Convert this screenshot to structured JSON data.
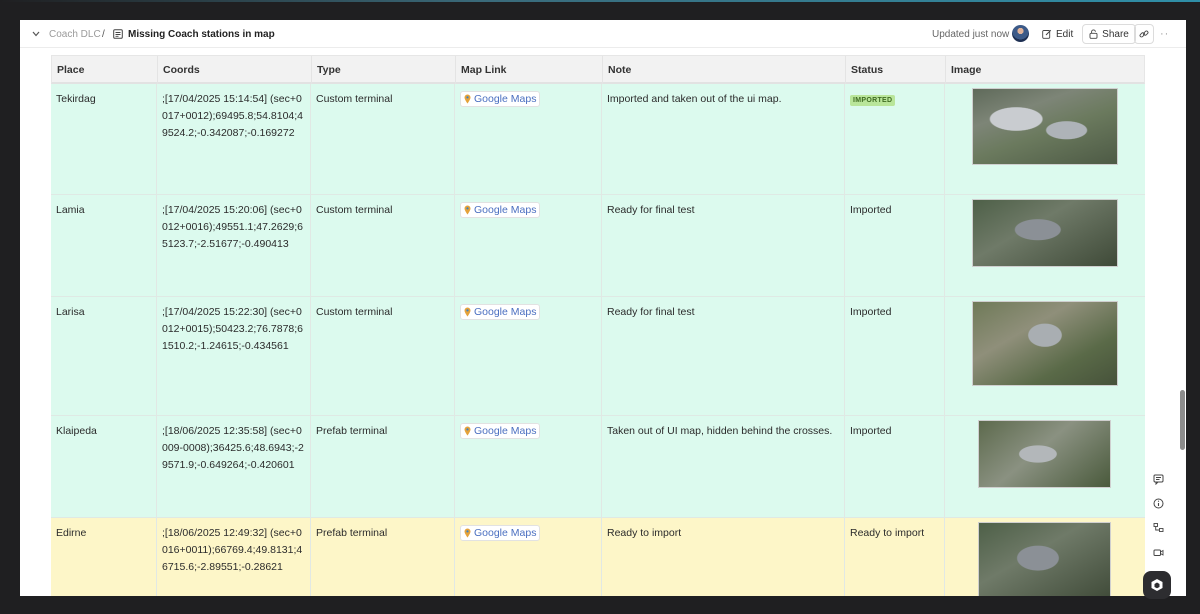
{
  "breadcrumb": {
    "parent": "Coach DLC",
    "separator": "/",
    "title": "Missing Coach stations in map"
  },
  "header": {
    "updated": "Updated just now",
    "edit_label": "Edit",
    "share_label": "Share"
  },
  "table": {
    "columns": [
      "Place",
      "Coords",
      "Type",
      "Map Link",
      "Note",
      "Status",
      "Image"
    ],
    "rows": [
      {
        "place": "Tekirdag",
        "coords": ";[17/04/2025 15:14:54] (sec+0017+0012);69495.8;54.8104;49524.2;-0.342087;-0.169272",
        "type": "Custom terminal",
        "map_link": "Google Maps",
        "note": "Imported and taken out of the ui map.",
        "status": "IMPORTED",
        "status_style": "badge"
      },
      {
        "place": "Lamia",
        "coords": ";[17/04/2025 15:20:06] (sec+0012+0016);49551.1;47.2629;65123.7;-2.51677;-0.490413",
        "type": "Custom terminal",
        "map_link": "Google Maps",
        "note": "Ready for final test",
        "status": "Imported",
        "status_style": "text"
      },
      {
        "place": "Larisa",
        "coords": ";[17/04/2025 15:22:30] (sec+0012+0015);50423.2;76.7878;61510.2;-1.24615;-0.434561",
        "type": "Custom terminal",
        "map_link": "Google Maps",
        "note": "Ready for final test",
        "status": "Imported",
        "status_style": "text"
      },
      {
        "place": "Klaipeda",
        "coords": " ;[18/06/2025 12:35:58] (sec+0009-0008);36425.6;48.6943;-29571.9;-0.649264;-0.420601",
        "type": "Prefab terminal",
        "map_link": "Google Maps",
        "note": "Taken out of UI map, hidden behind the crosses.",
        "status": "Imported",
        "status_style": "text"
      },
      {
        "place": "Edirne",
        "coords": " ;[18/06/2025 12:49:32] (sec+0016+0011);66769.4;49.8131;46715.6;-2.89551;-0.28621",
        "type": "Prefab terminal",
        "map_link": "Google Maps",
        "note": "Ready to import",
        "status": "Ready to import",
        "status_style": "text"
      }
    ]
  },
  "colors": {
    "row_green": "#dcfaee",
    "row_yellow": "#fdf6c8",
    "badge_bg": "#b9e59a",
    "link": "#4a6fc0"
  },
  "icons": [
    "chevron-down-icon",
    "page-icon",
    "edit-icon",
    "lock-icon",
    "link-icon",
    "more-icon",
    "comment-icon",
    "info-icon",
    "hierarchy-icon",
    "video-icon",
    "map-pin-icon",
    "app-logo-icon"
  ]
}
